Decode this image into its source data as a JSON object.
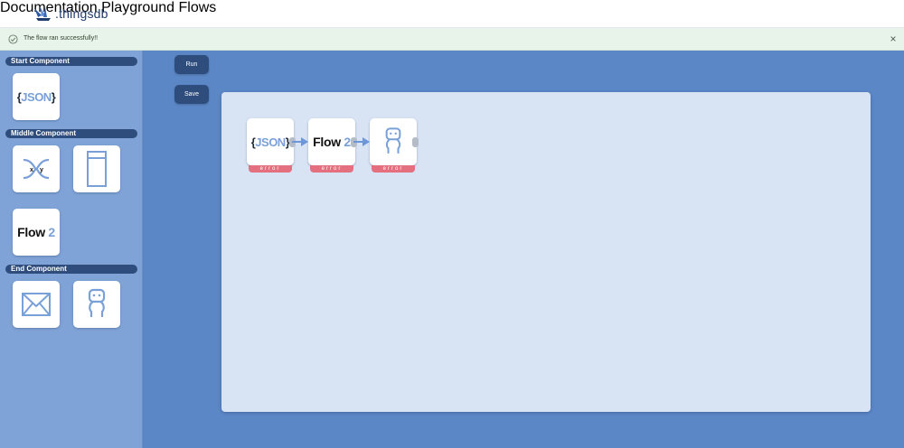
{
  "header": {
    "brand": ".thingsdb",
    "nav": [
      {
        "label": "Documentation"
      },
      {
        "label": "Playground"
      },
      {
        "label": "Flows"
      }
    ]
  },
  "banner": {
    "message": "The flow ran successfully!!",
    "close_glyph": "×",
    "status_color": "#e8f4e9"
  },
  "sidebar": {
    "sections": [
      {
        "title": "Start Component",
        "items": [
          {
            "icon": "json-icon",
            "label": "{JSON}"
          }
        ]
      },
      {
        "title": "Middle Component",
        "items": [
          {
            "icon": "xy-transform-icon",
            "label": "x y"
          },
          {
            "icon": "panel-icon"
          },
          {
            "icon": "flow2-icon",
            "label_main": "Flow",
            "label_num": "2"
          }
        ]
      },
      {
        "title": "End Component",
        "items": [
          {
            "icon": "mail-icon"
          },
          {
            "icon": "robot-icon"
          }
        ]
      }
    ]
  },
  "actions": {
    "run_label": "Run",
    "save_label": "Save"
  },
  "canvas": {
    "nodes": [
      {
        "icon": "json-icon",
        "label": "{JSON}",
        "status": "error"
      },
      {
        "icon": "flow2-icon",
        "label_main": "Flow",
        "label_num": "2",
        "status": "error"
      },
      {
        "icon": "robot-icon",
        "status": "error"
      }
    ]
  },
  "colors": {
    "accent": "#2e4d7d",
    "background": "#5b87c6",
    "canvas": "#d8e3f4",
    "error": "#e46f7f",
    "icon_blue": "#7aa0d8"
  }
}
